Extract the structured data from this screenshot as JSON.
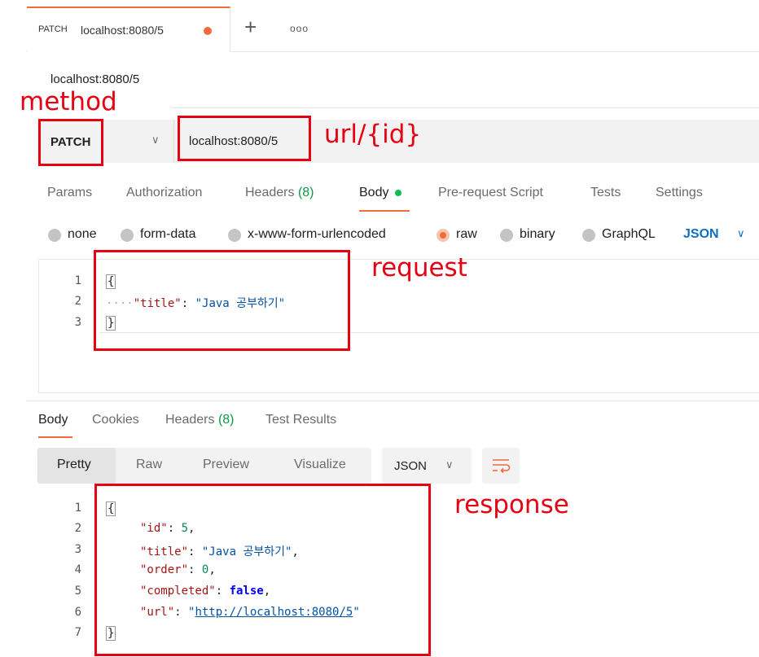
{
  "tab": {
    "method": "PATCH",
    "url": "localhost:8080/5",
    "new_tab": "+",
    "more": "ooo"
  },
  "request_title": "localhost:8080/5",
  "url_bar": {
    "method": "PATCH",
    "url": "localhost:8080/5"
  },
  "request_tabs": [
    "Params",
    "Authorization",
    "Headers",
    "(8)",
    "Body",
    "Pre-request Script",
    "Tests",
    "Settings"
  ],
  "body_types": [
    "none",
    "form-data",
    "x-www-form-urlencoded",
    "raw",
    "binary",
    "GraphQL"
  ],
  "body_format": "JSON",
  "request_body": {
    "line_numbers": [
      "1",
      "2",
      "3"
    ],
    "open": "{",
    "close": "}",
    "key": "\"title\"",
    "sep": ": ",
    "value": "\"Java 공부하기\"",
    "indent": "····"
  },
  "response_tabs": {
    "body": "Body",
    "cookies": "Cookies",
    "headers": "Headers",
    "headers_count": "(8)",
    "test_results": "Test Results"
  },
  "response_views": [
    "Pretty",
    "Raw",
    "Preview",
    "Visualize"
  ],
  "response_format": "JSON",
  "response_body": {
    "line_numbers": [
      "1",
      "2",
      "3",
      "4",
      "5",
      "6",
      "7"
    ],
    "open": "{",
    "close": "}",
    "id_key": "\"id\"",
    "id_val": "5",
    "title_key": "\"title\"",
    "title_val": "\"Java 공부하기\"",
    "order_key": "\"order\"",
    "order_val": "0",
    "completed_key": "\"completed\"",
    "completed_val": "false",
    "url_key": "\"url\"",
    "url_val": "http://localhost:8080/5"
  },
  "annotations": {
    "method": "method",
    "url": "url/{id}",
    "request": "request",
    "response": "response"
  },
  "colors": {
    "accent": "#f26b3a",
    "annotation": "#e60012",
    "link": "#0b6ec6",
    "success": "#0cbb52"
  }
}
